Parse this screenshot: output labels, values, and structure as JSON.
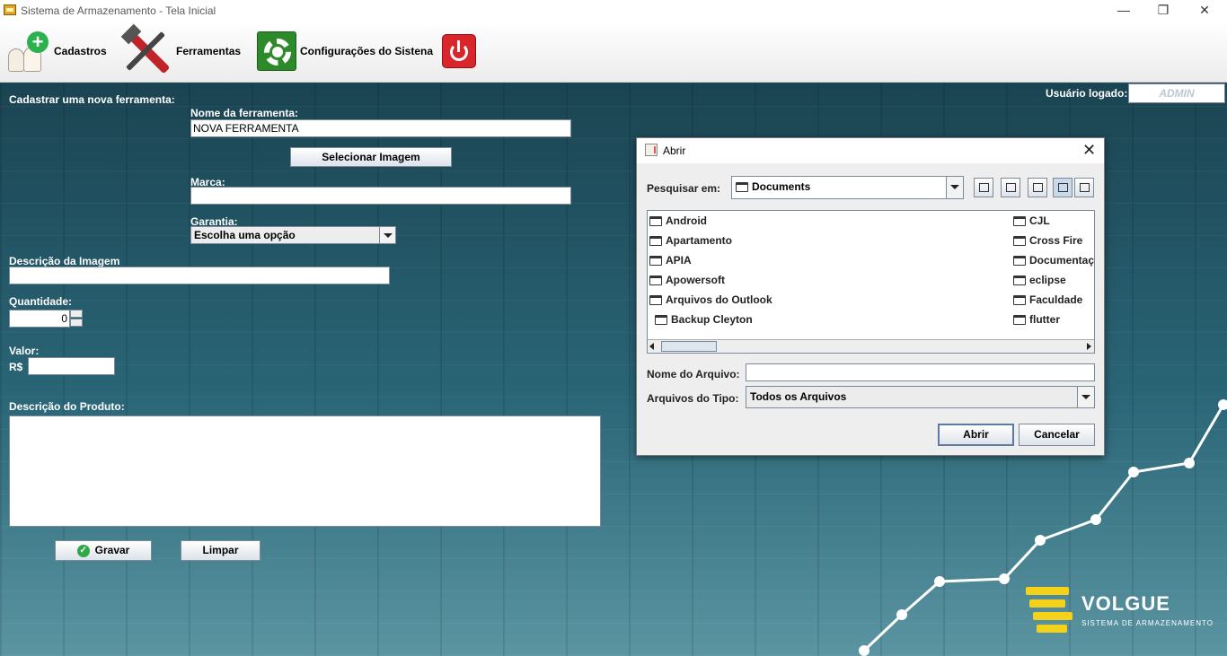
{
  "window": {
    "title": "Sistema de Armazenamento - Tela Inicial",
    "minimize": "—",
    "maximize": "❐",
    "close": "✕"
  },
  "toolbar": {
    "cadastros": "Cadastros",
    "ferramentas": "Ferramentas",
    "configuracoes": "Configurações do Sistena"
  },
  "user": {
    "label": "Usuário logado:",
    "value": "ADMIN"
  },
  "form": {
    "heading": "Cadastrar uma nova ferramenta:",
    "nome_label": "Nome da ferramenta:",
    "nome_value": "NOVA FERRAMENTA",
    "select_image_button": "Selecionar Imagem",
    "marca_label": "Marca:",
    "marca_value": "",
    "garantia_label": "Garantia:",
    "garantia_selected": "Escolha uma opção",
    "desc_imagem_label": "Descrição da Imagem",
    "desc_imagem_value": "",
    "quantidade_label": "Quantidade:",
    "quantidade_value": "0",
    "valor_label": "Valor:",
    "currency": "R$",
    "valor_value": "",
    "desc_produto_label": "Descrição do Produto:",
    "gravar_button": "Gravar",
    "limpar_button": "Limpar"
  },
  "logo": {
    "name": "VOLGUE",
    "subtitle": "SISTEMA DE ARMAZENAMENTO",
    "color": "#f5d21a"
  },
  "dialog": {
    "title": "Abrir",
    "close": "✕",
    "look_in_label": "Pesquisar em:",
    "look_in_value": "Documents",
    "files_col1": [
      "Android",
      "Apartamento",
      "APIA",
      "Apowersoft",
      "Arquivos do Outlook",
      "Backup Cleyton"
    ],
    "files_col2": [
      "CJL",
      "Cross Fire",
      "Documentaç",
      "eclipse",
      "Faculdade",
      "flutter"
    ],
    "file_name_label": "Nome do Arquivo:",
    "file_name_value": "",
    "file_type_label": "Arquivos do Tipo:",
    "file_type_value": "Todos os Arquivos",
    "open_button": "Abrir",
    "cancel_button": "Cancelar"
  }
}
